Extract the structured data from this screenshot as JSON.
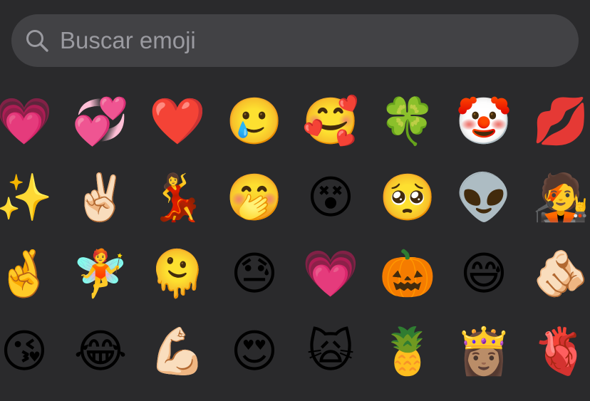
{
  "search": {
    "placeholder": "Buscar emoji",
    "value": ""
  },
  "colors": {
    "background": "#2a2a2c",
    "search_field": "#424245",
    "placeholder_text": "#9a9aa0"
  },
  "emoji_rows": [
    [
      {
        "name": "beating-heart-emoji",
        "char": "💗"
      },
      {
        "name": "revolving-hearts-emoji",
        "char": "💞"
      },
      {
        "name": "red-heart-emoji",
        "char": "❤️"
      },
      {
        "name": "face-holding-back-tears-emoji",
        "char": "🥲"
      },
      {
        "name": "smiling-face-with-hearts-emoji",
        "char": "🥰"
      },
      {
        "name": "four-leaf-clover-emoji",
        "char": "🍀"
      },
      {
        "name": "clown-face-emoji",
        "char": "🤡"
      },
      {
        "name": "kiss-mark-emoji",
        "char": "💋"
      }
    ],
    [
      {
        "name": "sparkles-emoji",
        "char": "✨"
      },
      {
        "name": "victory-hand-emoji",
        "char": "✌🏻"
      },
      {
        "name": "woman-dancing-emoji",
        "char": "💃"
      },
      {
        "name": "face-with-hand-over-mouth-emoji",
        "char": "🤭"
      },
      {
        "name": "face-with-crossed-out-eyes-emoji",
        "char": "😵"
      },
      {
        "name": "pleading-face-emoji",
        "char": "🥺"
      },
      {
        "name": "alien-emoji",
        "char": "👽"
      },
      {
        "name": "singer-emoji",
        "char": "🧑‍🎤"
      }
    ],
    [
      {
        "name": "memoji-peace-emoji",
        "char": "🤞"
      },
      {
        "name": "fairy-emoji",
        "char": "🧚"
      },
      {
        "name": "melting-face-emoji",
        "char": "🫠"
      },
      {
        "name": "downcast-face-with-sweat-emoji",
        "char": "😓"
      },
      {
        "name": "growing-heart-emoji",
        "char": "💗"
      },
      {
        "name": "jack-o-lantern-emoji",
        "char": "🎃"
      },
      {
        "name": "grinning-face-with-sweat-emoji",
        "char": "😅"
      },
      {
        "name": "backhand-index-pointing-at-viewer-emoji",
        "char": "🫵🏻"
      }
    ],
    [
      {
        "name": "face-blowing-a-kiss-emoji",
        "char": "😘"
      },
      {
        "name": "face-with-tears-of-joy-emoji",
        "char": "😂"
      },
      {
        "name": "flexed-biceps-emoji",
        "char": "💪🏻"
      },
      {
        "name": "smiling-face-with-heart-eyes-emoji",
        "char": "😍"
      },
      {
        "name": "weary-cat-emoji",
        "char": "🙀"
      },
      {
        "name": "pineapple-emoji",
        "char": "🍍"
      },
      {
        "name": "person-with-crown-emoji",
        "char": "👸🏽"
      },
      {
        "name": "anatomical-heart-emoji",
        "char": "🫀"
      }
    ]
  ]
}
